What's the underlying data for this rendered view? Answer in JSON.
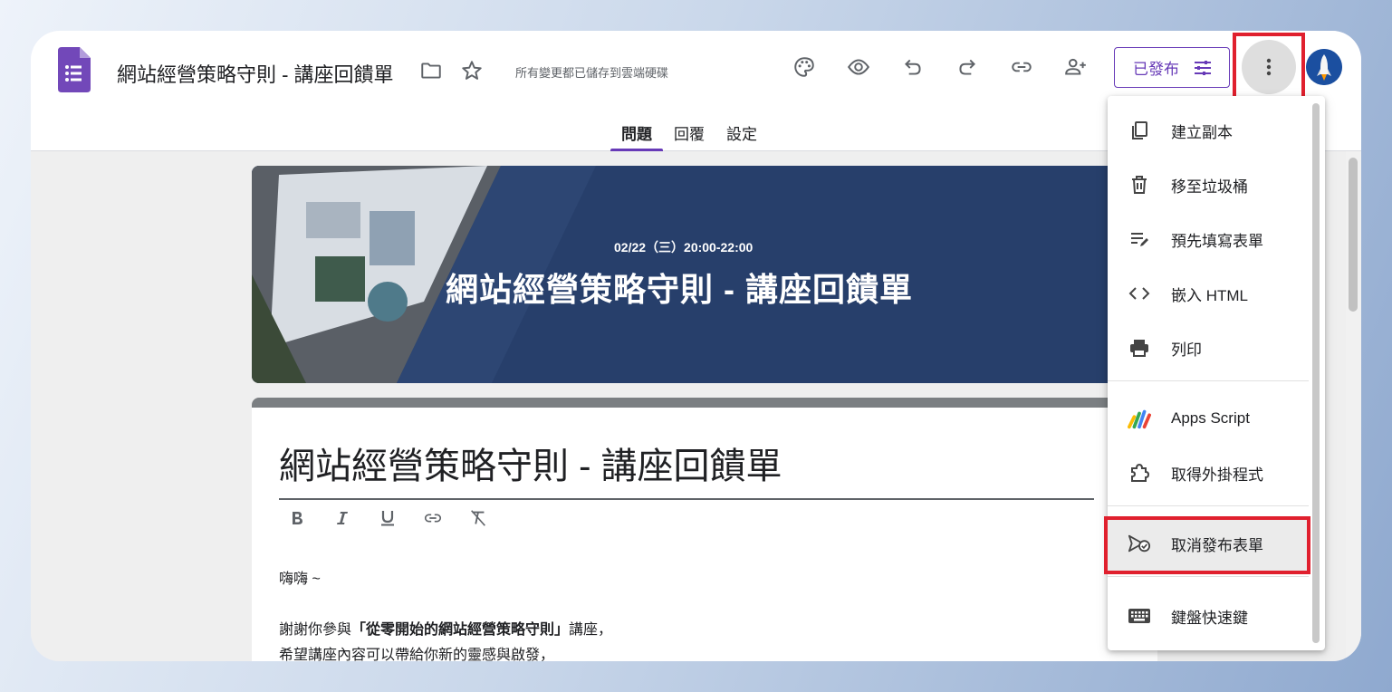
{
  "doc": {
    "title": "網站經營策略守則 - 講座回饋單",
    "save_status": "所有變更都已儲存到雲端硬碟"
  },
  "toolbar": {
    "publish_label": "已發布"
  },
  "tabs": [
    {
      "label": "問題",
      "active": true
    },
    {
      "label": "回覆",
      "active": false
    },
    {
      "label": "設定",
      "active": false
    }
  ],
  "banner": {
    "date": "02/22（三）20:00-22:00",
    "title": "網站經營策略守則 - 講座回饋單"
  },
  "form": {
    "title": "網站經營策略守則 - 講座回饋單",
    "desc_line1": "嗨嗨 ~",
    "desc_line2_pre": "謝謝你參與",
    "desc_line2_bold": "「從零開始的網站經營策略守則」",
    "desc_line2_post": "講座，",
    "desc_line3": "希望講座內容可以帶給你新的靈感與啟發，"
  },
  "menu": {
    "items": [
      {
        "label": "建立副本",
        "icon": "copy-icon"
      },
      {
        "label": "移至垃圾桶",
        "icon": "trash-icon"
      },
      {
        "label": "預先填寫表單",
        "icon": "prefill-icon"
      },
      {
        "label": "嵌入 HTML",
        "icon": "code-icon"
      },
      {
        "label": "列印",
        "icon": "print-icon"
      },
      {
        "label": "Apps Script",
        "icon": "apps-script-icon"
      },
      {
        "label": "取得外掛程式",
        "icon": "puzzle-icon"
      },
      {
        "label": "取消發布表單",
        "icon": "unpublish-icon",
        "highlighted": true
      },
      {
        "label": "鍵盤快速鍵",
        "icon": "keyboard-icon"
      }
    ]
  },
  "colors": {
    "accent": "#673ab7",
    "highlight_box": "#e0202e",
    "banner_bg": "#273f6b"
  }
}
